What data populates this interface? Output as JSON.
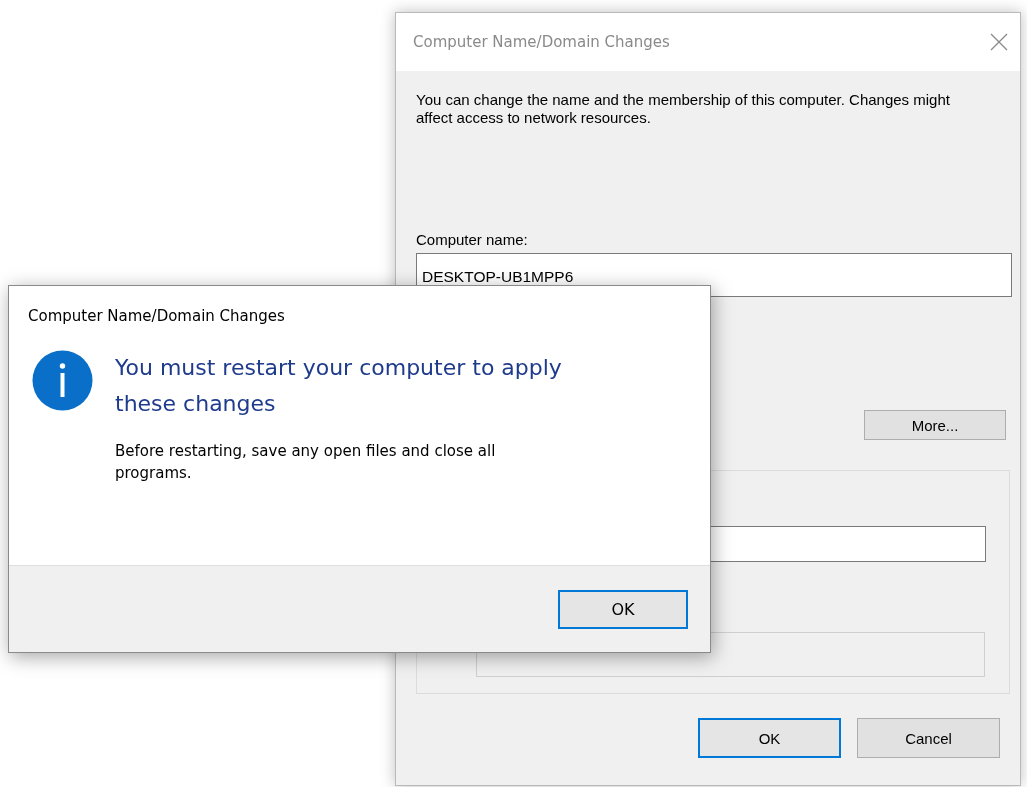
{
  "back_window": {
    "title": "Computer Name/Domain Changes",
    "description": "You can change the name and the membership of this computer. Changes might affect access to network resources.",
    "computer_name_label": "Computer name:",
    "computer_name_value": "DESKTOP-UB1MPP6",
    "more_button": "More...",
    "workgroup_field": {
      "disabled": true
    },
    "buttons": [
      {
        "label": "OK",
        "default": true
      },
      {
        "label": "Cancel",
        "default": false
      }
    ]
  },
  "message_box": {
    "title": "Computer Name/Domain Changes",
    "heading": "You must restart your computer to apply these changes",
    "body": "Before restarting, save any open files and close all programs.",
    "buttons": [
      {
        "label": "OK",
        "default": true
      }
    ]
  }
}
